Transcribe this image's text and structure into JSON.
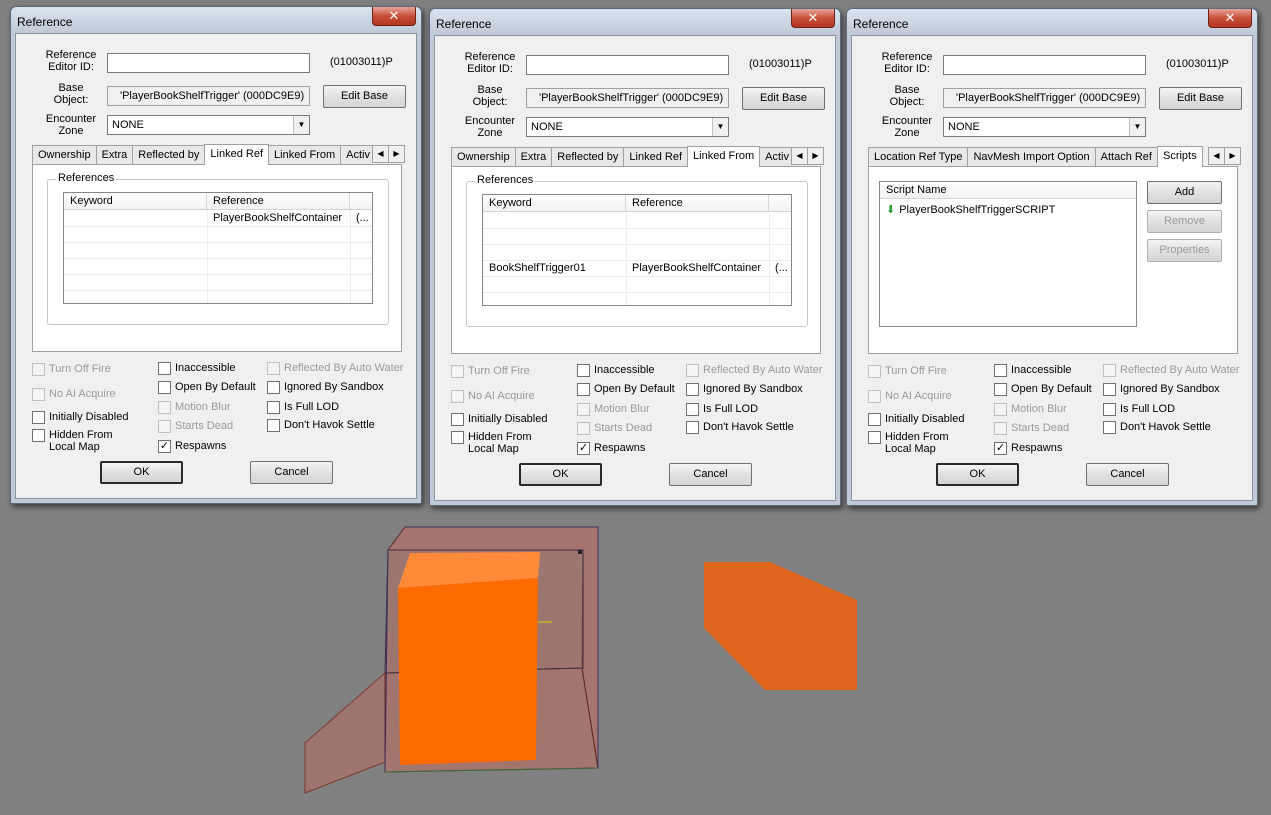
{
  "dialogs": [
    {
      "title": "Reference",
      "editor_id_label": "Reference\nEditor ID:",
      "editor_id_value": "",
      "form_id": "(01003011)P",
      "base_object_label": "Base\nObject:",
      "base_object_value": "'PlayerBookShelfTrigger' (000DC9E9)",
      "edit_base_label": "Edit Base",
      "encounter_zone_label": "Encounter\nZone",
      "encounter_zone_value": "NONE",
      "tabs": [
        "Ownership",
        "Extra",
        "Reflected by",
        "Linked Ref",
        "Linked From",
        "Activ"
      ],
      "selected_tab": "Linked Ref",
      "group_title": "References",
      "columns": [
        "Keyword",
        "Reference"
      ],
      "rows": [
        {
          "keyword": "",
          "reference": "PlayerBookShelfContainer",
          "extra": "(..."
        }
      ]
    },
    {
      "title": "Reference",
      "editor_id_label": "Reference\nEditor ID:",
      "editor_id_value": "",
      "form_id": "(01003011)P",
      "base_object_label": "Base\nObject:",
      "base_object_value": "'PlayerBookShelfTrigger' (000DC9E9)",
      "edit_base_label": "Edit Base",
      "encounter_zone_label": "Encounter\nZone",
      "encounter_zone_value": "NONE",
      "tabs": [
        "Ownership",
        "Extra",
        "Reflected by",
        "Linked Ref",
        "Linked From",
        "Activ"
      ],
      "selected_tab": "Linked From",
      "group_title": "References",
      "columns": [
        "Keyword",
        "Reference"
      ],
      "rows": [
        {
          "keyword": "BookShelfTrigger01",
          "reference": "PlayerBookShelfContainer",
          "extra": "(..."
        }
      ]
    },
    {
      "title": "Reference",
      "editor_id_label": "Reference\nEditor ID:",
      "editor_id_value": "",
      "form_id": "(01003011)P",
      "base_object_label": "Base\nObject:",
      "base_object_value": "'PlayerBookShelfTrigger' (000DC9E9)",
      "edit_base_label": "Edit Base",
      "encounter_zone_label": "Encounter\nZone",
      "encounter_zone_value": "NONE",
      "tabs": [
        "Location Ref Type",
        "NavMesh Import Option",
        "Attach Ref",
        "Scripts"
      ],
      "selected_tab": "Scripts",
      "scripts_header": "Script Name",
      "scripts": [
        "PlayerBookShelfTriggerSCRIPT"
      ],
      "script_buttons": {
        "add": "Add",
        "remove": "Remove",
        "properties": "Properties"
      }
    }
  ],
  "flags": {
    "turn_off_fire": "Turn Off Fire",
    "no_ai_acquire": "No AI Acquire",
    "initially_disabled": "Initially Disabled",
    "hidden_from_local_map": "Hidden From\nLocal Map",
    "inaccessible": "Inaccessible",
    "open_by_default": "Open By Default",
    "motion_blur": "Motion Blur",
    "starts_dead": "Starts Dead",
    "respawns": "Respawns",
    "reflected_by_auto_water": "Reflected By Auto Water",
    "ignored_by_sandbox": "Ignored By Sandbox",
    "is_full_lod": "Is Full LOD",
    "dont_havok_settle": "Don't Havok Settle"
  },
  "flag_states": {
    "respawns_checked": true
  },
  "buttons": {
    "ok": "OK",
    "cancel": "Cancel"
  },
  "glyphs": {
    "close": "✕",
    "left": "◀",
    "right": "▶",
    "dropdown": "▼",
    "check": "✓",
    "script_arrow": "⬇"
  },
  "colors": {
    "trigger_orange": "#ff6a00",
    "trigger_box": "#c46a5e",
    "viewport": "#808080"
  }
}
